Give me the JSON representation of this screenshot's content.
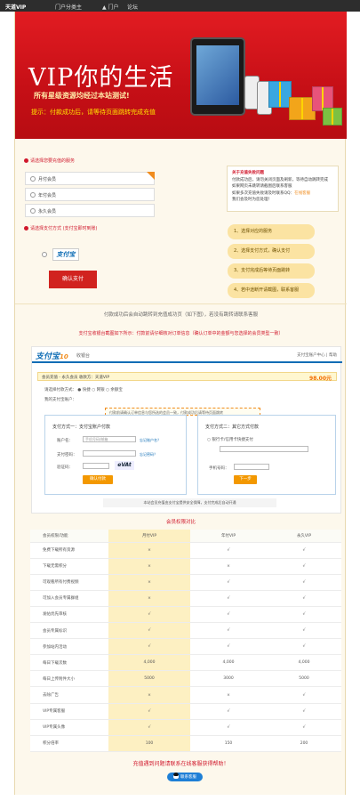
{
  "topbar": {
    "items": [
      "天道VIP",
      "门户分类主",
      "门户",
      "论坛"
    ]
  },
  "banner": {
    "title": "VIP你的生活",
    "subtitle": "所有星级资源均经过本站测试!",
    "hint": "提示：付款成功后，请等待页面跳转完成充值"
  },
  "form": {
    "vip_label": "请选择您要充值的服务",
    "options": [
      "月付会员",
      "年付会员",
      "永久会员"
    ],
    "pay_label": "请选择支付方式",
    "pay_hint": "(支付宝即时到账)",
    "pay_logo": "支付宝",
    "confirm": "确认支付"
  },
  "notice": {
    "title": "关于充值失败问题",
    "lines": [
      "付款成功后，请勿关闭页面及刷新，等待自动跳转完成",
      "如果网页未跳转请截图后联系客服",
      "如果多次充值失败请及时联系QQ："
    ],
    "contact": "在线客服",
    "tail": "我们会及时为您处理！"
  },
  "steps": [
    "1、选择对应的服务",
    "2、选择支付方式，确认支付",
    "3、支付完成后等待页面跳转",
    "4、若中途断开请截图，联系客服"
  ],
  "section": {
    "line1": "付款成功后会自动跳转到充值成功页（如下图），若没有跳转请联系客服",
    "line2": "支付宝收银台截图如下所示：付款前请仔细核对订单信息（确认订单中的金额与您选择的会员类型一致）"
  },
  "alipay": {
    "logo": "支付宝",
    "year": "10",
    "cashier": "收银台",
    "link": "支付宝账户中心 | 帮助",
    "order_text": "会员充值 - 永久会员  收款方：天道VIP",
    "amount": "98.00元",
    "row1": "请选择付款方式：   ● 快捷   ○ 网银   ○ 余额宝",
    "row2": "我的支付宝账户：",
    "tip": "付款前请确认订单信息与您所选的会员一致，付款成功后请等待页面跳转",
    "left_title": "支付方式一：支付宝账户付款",
    "account_label": "账户名：",
    "account_placeholder": "手机号码/邮箱",
    "forgot_account": "忘记账户名？",
    "pwd_label": "支付密码：",
    "forgot_pwd": "忘记密码？",
    "code_label": "验证码：",
    "captcha": "eVAt",
    "pay_btn": "确认付款",
    "right_title": "支付方式二：其它方式付款",
    "right_row": "银行卡/信用卡快捷支付",
    "phone_label": "手机号码：",
    "right_btn": "下一步",
    "footer": "本站会员充值由支付宝提供安全保障，支付完成后自动开通"
  },
  "compare": {
    "title": "会员权限对比",
    "headers": [
      "会员权限/功能",
      "月付VIP",
      "年付VIP",
      "永久VIP"
    ],
    "rows": [
      [
        "免费下载所有资源",
        "×",
        "√",
        "√"
      ],
      [
        "下载无需积分",
        "×",
        "×",
        "√"
      ],
      [
        "可观看所有付费视频",
        "×",
        "√",
        "√"
      ],
      [
        "可加入会员专属群组",
        "×",
        "√",
        "√"
      ],
      [
        "发帖优先审核",
        "√",
        "√",
        "√"
      ],
      [
        "会员专属标识",
        "√",
        "√",
        "√"
      ],
      [
        "参加站内活动",
        "√",
        "√",
        "√"
      ],
      [
        "每日下载次数",
        "4,000",
        "4,000",
        "4,000"
      ],
      [
        "每日上传附件大小",
        "5000",
        "3000",
        "5000"
      ],
      [
        "去除广告",
        "×",
        "×",
        "√"
      ],
      [
        "VIP专属客服",
        "√",
        "√",
        "√"
      ],
      [
        "VIP专属头像",
        "√",
        "√",
        "√"
      ],
      [
        "积分倍率",
        "100",
        "150",
        "200"
      ]
    ]
  },
  "footer": {
    "note": "充值遇到问题请联系在线客服获得帮助！",
    "qq": "联系客服"
  }
}
